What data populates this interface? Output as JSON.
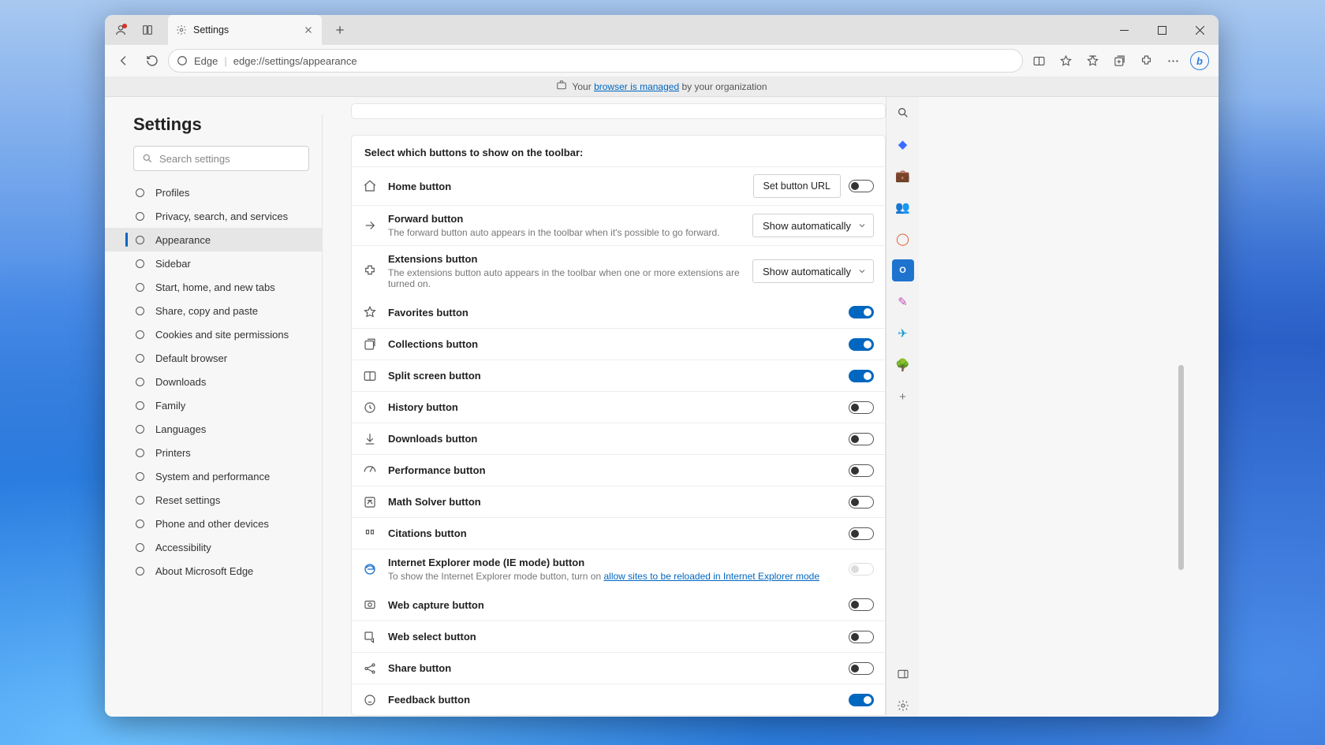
{
  "tab": {
    "title": "Settings"
  },
  "address": {
    "prefix": "Edge",
    "url": "edge://settings/appearance"
  },
  "infobar": {
    "pre": "Your ",
    "link": "browser is managed",
    "post": " by your organization"
  },
  "settings_title": "Settings",
  "search_placeholder": "Search settings",
  "sidebar": [
    {
      "label": "Profiles",
      "active": false
    },
    {
      "label": "Privacy, search, and services",
      "active": false
    },
    {
      "label": "Appearance",
      "active": true
    },
    {
      "label": "Sidebar",
      "active": false
    },
    {
      "label": "Start, home, and new tabs",
      "active": false
    },
    {
      "label": "Share, copy and paste",
      "active": false
    },
    {
      "label": "Cookies and site permissions",
      "active": false
    },
    {
      "label": "Default browser",
      "active": false
    },
    {
      "label": "Downloads",
      "active": false
    },
    {
      "label": "Family",
      "active": false
    },
    {
      "label": "Languages",
      "active": false
    },
    {
      "label": "Printers",
      "active": false
    },
    {
      "label": "System and performance",
      "active": false
    },
    {
      "label": "Reset settings",
      "active": false
    },
    {
      "label": "Phone and other devices",
      "active": false
    },
    {
      "label": "Accessibility",
      "active": false
    },
    {
      "label": "About Microsoft Edge",
      "active": false
    }
  ],
  "toolbar_section": {
    "heading": "Select which buttons to show on the toolbar:",
    "home": {
      "label": "Home button",
      "action": "Set button URL",
      "toggle": false
    },
    "forward": {
      "label": "Forward button",
      "sub": "The forward button auto appears in the toolbar when it's possible to go forward.",
      "select": "Show automatically"
    },
    "extensions": {
      "label": "Extensions button",
      "sub": "The extensions button auto appears in the toolbar when one or more extensions are turned on.",
      "select": "Show automatically"
    },
    "rows": [
      {
        "label": "Favorites button",
        "on": true
      },
      {
        "label": "Collections button",
        "on": true
      },
      {
        "label": "Split screen button",
        "on": true
      },
      {
        "label": "History button",
        "on": false
      },
      {
        "label": "Downloads button",
        "on": false
      },
      {
        "label": "Performance button",
        "on": false
      },
      {
        "label": "Math Solver button",
        "on": false
      },
      {
        "label": "Citations button",
        "on": false
      }
    ],
    "ie_row": {
      "label": "Internet Explorer mode (IE mode) button",
      "sub_pre": "To show the Internet Explorer mode button, turn on ",
      "sub_link": "allow sites to be reloaded in Internet Explorer mode"
    },
    "rows2": [
      {
        "label": "Web capture button",
        "on": false
      },
      {
        "label": "Web select button",
        "on": false
      },
      {
        "label": "Share button",
        "on": false
      },
      {
        "label": "Feedback button",
        "on": true
      }
    ]
  }
}
